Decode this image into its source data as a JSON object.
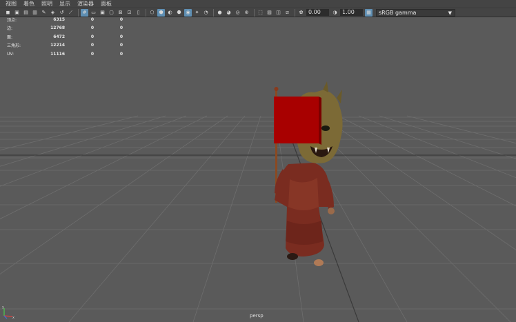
{
  "menu": [
    "视图",
    "着色",
    "照明",
    "显示",
    "渲染器",
    "面板"
  ],
  "toolbar": {
    "exposure_value": "0.00",
    "gamma_value": "1.00",
    "color_space": "sRGB gamma"
  },
  "hud": {
    "rows": [
      {
        "label": "顶点:",
        "a": "6315",
        "b": "0",
        "c": "0"
      },
      {
        "label": "边:",
        "a": "12768",
        "b": "0",
        "c": "0"
      },
      {
        "label": "面:",
        "a": "6472",
        "b": "0",
        "c": "0"
      },
      {
        "label": "三角形:",
        "a": "12214",
        "b": "0",
        "c": "0"
      },
      {
        "label": "UV:",
        "a": "11116",
        "b": "0",
        "c": "0"
      }
    ]
  },
  "viewport": {
    "camera": "persp"
  }
}
